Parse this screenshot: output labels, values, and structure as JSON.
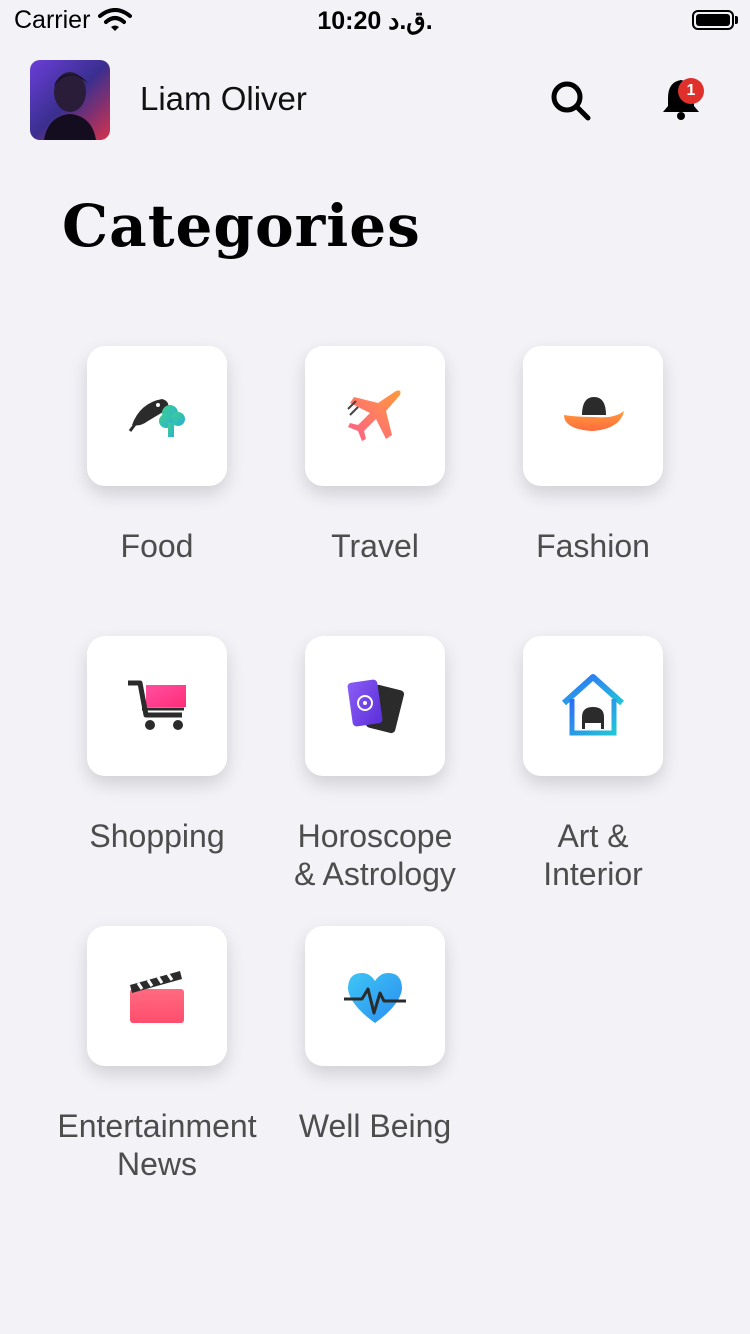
{
  "status_bar": {
    "carrier": "Carrier",
    "time": "10:20 ق.د."
  },
  "header": {
    "user_name": "Liam Oliver",
    "notification_count": "1"
  },
  "page_title": "Categories",
  "categories": [
    {
      "label": "Food",
      "icon": "food-icon"
    },
    {
      "label": "Travel",
      "icon": "plane-icon"
    },
    {
      "label": "Fashion",
      "icon": "hat-icon"
    },
    {
      "label": "Shopping",
      "icon": "cart-icon"
    },
    {
      "label": "Horoscope\n& Astrology",
      "icon": "tarot-cards-icon"
    },
    {
      "label": "Art &\nInterior",
      "icon": "house-chair-icon"
    },
    {
      "label": "Entertainment\nNews",
      "icon": "clapperboard-icon"
    },
    {
      "label": "Well Being",
      "icon": "heart-pulse-icon"
    }
  ]
}
